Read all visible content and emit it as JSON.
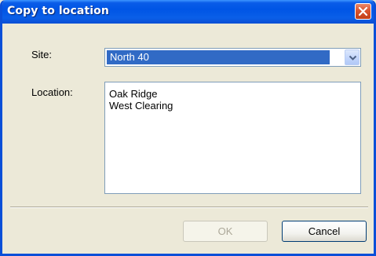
{
  "window": {
    "title": "Copy to location",
    "close_icon": "close-icon"
  },
  "form": {
    "site_label": "Site:",
    "site_value": "North 40",
    "location_label": "Location:",
    "locations": [
      "Oak Ridge",
      "West Clearing"
    ]
  },
  "buttons": {
    "ok_label": "OK",
    "ok_enabled": false,
    "cancel_label": "Cancel"
  },
  "colors": {
    "titlebar": "#0055e5",
    "selection": "#316ac5",
    "close_button": "#d9542e"
  }
}
